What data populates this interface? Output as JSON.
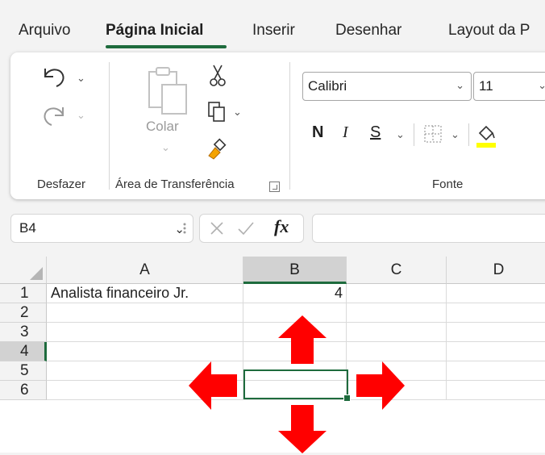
{
  "tabs": [
    {
      "label": "Arquivo",
      "active": false
    },
    {
      "label": "Página Inicial",
      "active": true
    },
    {
      "label": "Inserir",
      "active": false
    },
    {
      "label": "Desenhar",
      "active": false
    },
    {
      "label": "Layout da P",
      "active": false
    }
  ],
  "ribbon": {
    "undo_group_label": "Desfazer",
    "clipboard_group_label": "Área de Transferência",
    "paste_label": "Colar",
    "font_group_label": "Fonte",
    "font_name": "Calibri",
    "font_size": "11",
    "bold_label": "N",
    "italic_label": "I",
    "strike_label": "S",
    "fill_color": "#ffff00"
  },
  "formula_bar": {
    "name_box": "B4",
    "fx_label": "fx",
    "formula_value": ""
  },
  "sheet": {
    "columns": [
      "A",
      "B",
      "C",
      "D"
    ],
    "selected_column": "B",
    "rows": [
      "1",
      "2",
      "3",
      "4",
      "5",
      "6"
    ],
    "selected_row": "4",
    "cells": {
      "A1": "Analista financeiro Jr.",
      "B1": "4"
    },
    "active_cell": "B4"
  },
  "overlay": {
    "arrow_color": "#ff0000",
    "arrows": [
      "up",
      "down",
      "left",
      "right"
    ]
  },
  "colors": {
    "accent_green": "#1e6b3d",
    "ribbon_bg": "#ffffff",
    "window_bg": "#f3f3f3"
  }
}
